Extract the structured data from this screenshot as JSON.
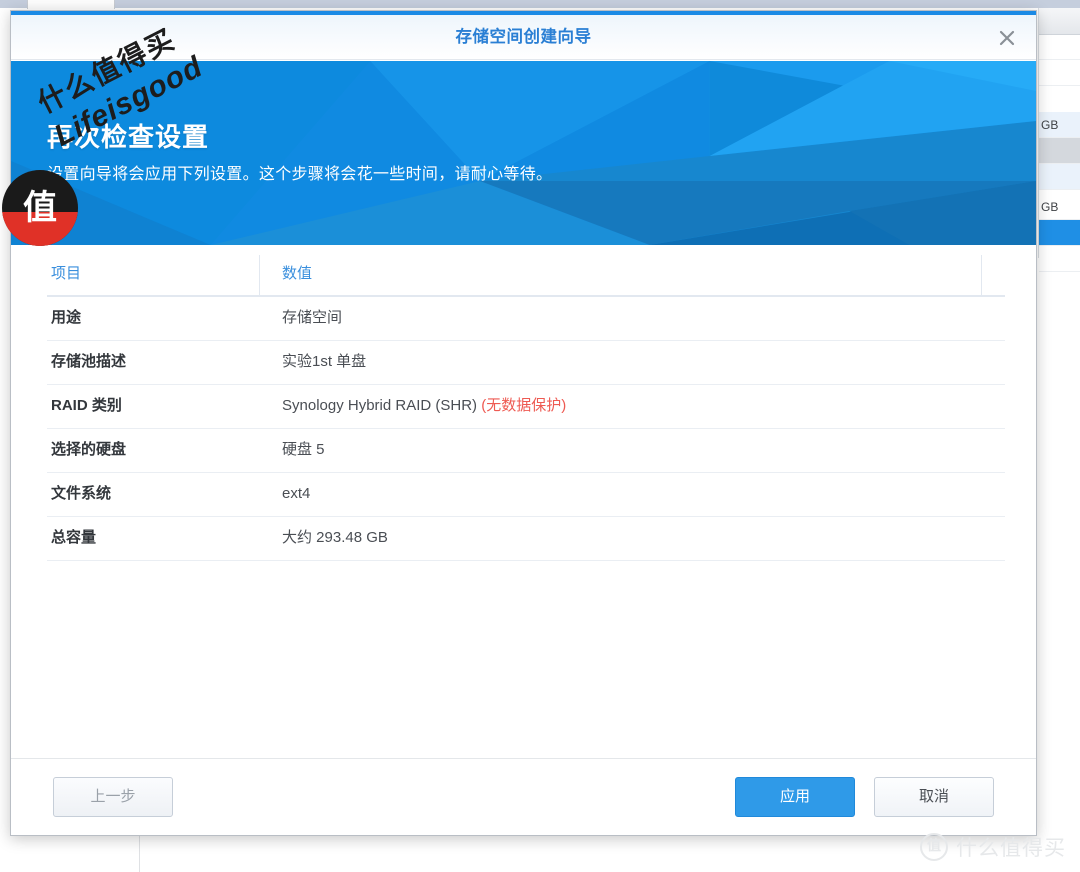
{
  "window": {
    "title": "存储空间创建向导",
    "close_icon": "close-icon",
    "accent_color": "#1b8ae5",
    "title_color": "#2a7fd4"
  },
  "hero": {
    "heading": "再次检查设置",
    "subtitle": "设置向导将会应用下列设置。这个步骤将会花一些时间，请耐心等待。",
    "background_color": "#118ae0"
  },
  "summary_table": {
    "columns": [
      "项目",
      "数值",
      ""
    ],
    "rows": [
      {
        "key": "用途",
        "value": "存储空间",
        "value_warn": ""
      },
      {
        "key": "存储池描述",
        "value": "实验1st 单盘",
        "value_warn": ""
      },
      {
        "key": "RAID 类别",
        "value": "Synology Hybrid RAID (SHR)",
        "value_warn": "(无数据保护)"
      },
      {
        "key": "选择的硬盘",
        "value": "硬盘 5",
        "value_warn": ""
      },
      {
        "key": "文件系统",
        "value": "ext4",
        "value_warn": ""
      },
      {
        "key": "总容量",
        "value": "大约 293.48 GB",
        "value_warn": ""
      }
    ],
    "warn_color": "#ee5a52"
  },
  "footer": {
    "back_label": "上一步",
    "apply_label": "应用",
    "cancel_label": "取消",
    "apply_color": "#2f9ae8"
  },
  "background": {
    "table_rows": [
      "",
      "",
      "GB",
      "",
      "",
      "GB",
      "",
      ""
    ]
  },
  "watermark": {
    "badge_glyph": "值",
    "line_cn": "什么值得买",
    "line_en": "Lifeisgood",
    "corner_glyph": "值",
    "corner_text": "什么值得买"
  }
}
